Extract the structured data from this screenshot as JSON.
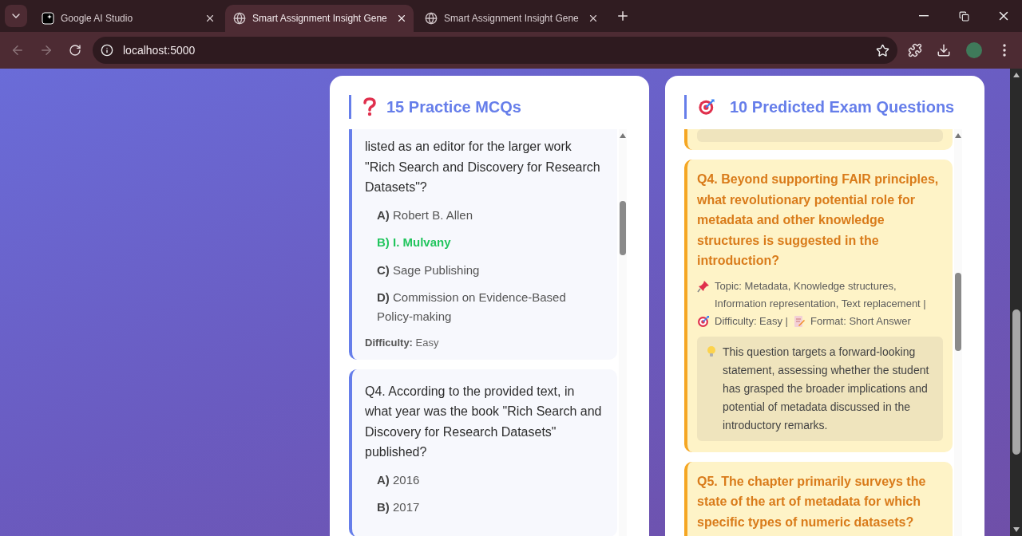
{
  "browser": {
    "tabs": [
      {
        "title": "Google AI Studio",
        "kind": "studio",
        "selected": false
      },
      {
        "title": "Smart Assignment Insight Gene",
        "kind": "web",
        "selected": true
      },
      {
        "title": "Smart Assignment Insight Gene",
        "kind": "web",
        "selected": false
      }
    ],
    "address": "localhost:5000"
  },
  "mcq_panel": {
    "title": "15 Practice MCQs",
    "questions": [
      {
        "text": "listed as an editor for the larger work \"Rich Search and Discovery for Research Datasets\"?",
        "options": [
          {
            "text": "**A)** Robert B. Allen",
            "correct": false
          },
          {
            "text": "**B)** I. Mulvany",
            "correct": true
          },
          {
            "text": "**C)** Sage Publishing",
            "correct": false
          },
          {
            "text": "**D)** Commission on Evidence-Based Policy-making",
            "correct": false
          }
        ],
        "difficulty": "**Difficulty:** Easy"
      },
      {
        "text": "Q4. According to the provided text, in what year was the book \"Rich Search and Discovery for Research Datasets\" published?",
        "options": [
          {
            "text": "**A)** 2016",
            "correct": false
          },
          {
            "text": "**B)** 2017",
            "correct": false
          }
        ]
      }
    ]
  },
  "exam_panel": {
    "title": "10 Predicted Exam Questions",
    "questions": [
      {
        "kind": "clipped"
      },
      {
        "kind": "full",
        "text": "Q4. Beyond supporting FAIR principles, what revolutionary potential role for metadata and other knowledge structures is suggested in the introduction?",
        "topic": "Topic: Metadata, Knowledge structures, Information representation, Text replacement |",
        "difficulty": "Difficulty: Easy |",
        "format": "Format: Short Answer",
        "hint": "This question targets a forward-looking statement, assessing whether the student has grasped the broader implications and potential of metadata discussed in the introductory remarks."
      },
      {
        "kind": "full",
        "text": "Q5. The chapter primarily surveys the state of the art of metadata for which specific types of numeric datasets?"
      }
    ]
  }
}
